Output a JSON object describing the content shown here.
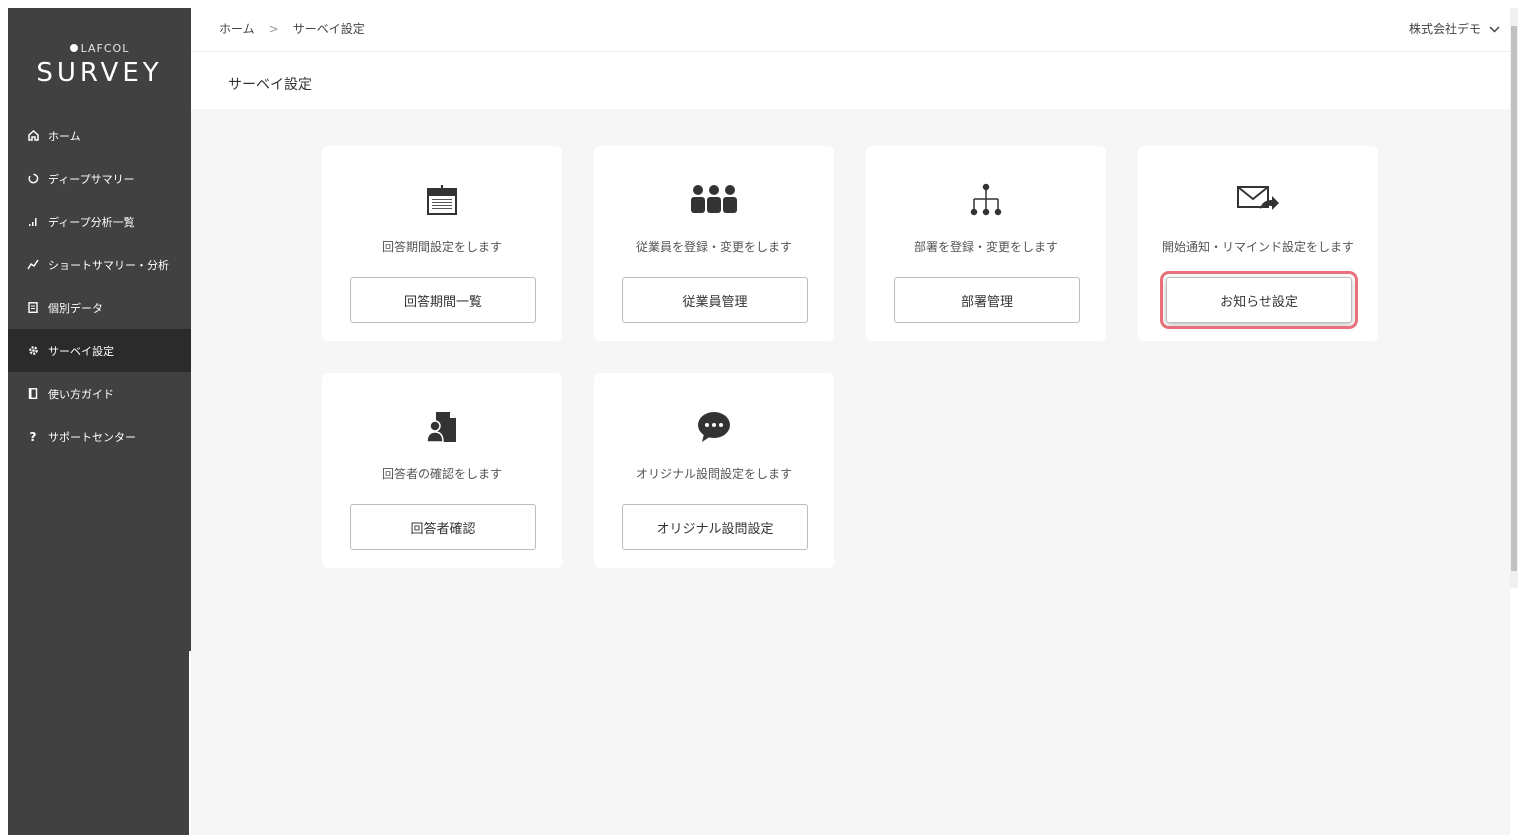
{
  "brand": {
    "small": "LAFCOL",
    "big": "SURVEY"
  },
  "sidebar": {
    "items": [
      {
        "label": "ホーム",
        "icon": "home-icon"
      },
      {
        "label": "ディープサマリー",
        "icon": "circle-arrow-icon"
      },
      {
        "label": "ディープ分析一覧",
        "icon": "bar-chart-icon"
      },
      {
        "label": "ショートサマリー・分析",
        "icon": "line-chart-icon"
      },
      {
        "label": "個別データ",
        "icon": "document-icon"
      },
      {
        "label": "サーベイ設定",
        "icon": "gear-icon",
        "active": true
      },
      {
        "label": "使い方ガイド",
        "icon": "book-icon"
      },
      {
        "label": "サポートセンター",
        "icon": "question-icon"
      }
    ]
  },
  "header": {
    "breadcrumb": [
      "ホーム",
      "サーベイ設定"
    ],
    "separator": ">",
    "company": "株式会社デモ"
  },
  "page": {
    "title": "サーベイ設定"
  },
  "cards": [
    {
      "icon": "calendar-icon",
      "description": "回答期間設定をします",
      "button": "回答期間一覧"
    },
    {
      "icon": "people-group-icon",
      "description": "従業員を登録・変更をします",
      "button": "従業員管理"
    },
    {
      "icon": "org-chart-icon",
      "description": "部署を登録・変更をします",
      "button": "部署管理"
    },
    {
      "icon": "mail-forward-icon",
      "description": "開始通知・リマインド設定をします",
      "button": "お知らせ設定",
      "highlighted": true
    },
    {
      "icon": "person-document-icon",
      "description": "回答者の確認をします",
      "button": "回答者確認"
    },
    {
      "icon": "chat-bubble-icon",
      "description": "オリジナル設問設定をします",
      "button": "オリジナル設問設定"
    }
  ],
  "colors": {
    "sidebar": "#414141",
    "sidebar_active": "#2b2b2b",
    "main_bg": "#f6f6f6",
    "highlight": "#e8707a"
  }
}
